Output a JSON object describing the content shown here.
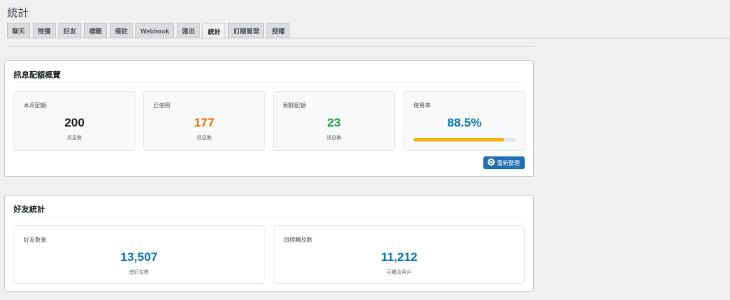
{
  "page": {
    "title": "統計"
  },
  "tabs": [
    {
      "label": "聊天"
    },
    {
      "label": "推播"
    },
    {
      "label": "好友"
    },
    {
      "label": "標籤"
    },
    {
      "label": "備註"
    },
    {
      "label": "Webhook"
    },
    {
      "label": "匯出"
    },
    {
      "label": "統計",
      "active": true
    },
    {
      "label": "訂閱管理"
    },
    {
      "label": "授權"
    }
  ],
  "quota": {
    "title": "訊息配額概覽",
    "cards": [
      {
        "label": "本月配額",
        "value": "200",
        "sub": "訊息數",
        "color": "#1d2327"
      },
      {
        "label": "已使用",
        "value": "177",
        "sub": "訊息數",
        "color": "#ff6900"
      },
      {
        "label": "剩餘配額",
        "value": "23",
        "sub": "訊息數",
        "color": "#22a244"
      },
      {
        "label": "使用率",
        "value": "88.5%",
        "progress": 0.885,
        "color": "#0a7aba"
      }
    ],
    "refresh_label": "重新整理",
    "refresh_icon": "refresh-icon"
  },
  "friends": {
    "title": "好友統計",
    "cards": [
      {
        "label": "好友數量",
        "value": "13,507",
        "sub": "總好友數",
        "color": "#0a7aba"
      },
      {
        "label": "目標觸及數",
        "value": "11,212",
        "sub": "可觸及用戶",
        "color": "#0a7aba"
      }
    ]
  }
}
